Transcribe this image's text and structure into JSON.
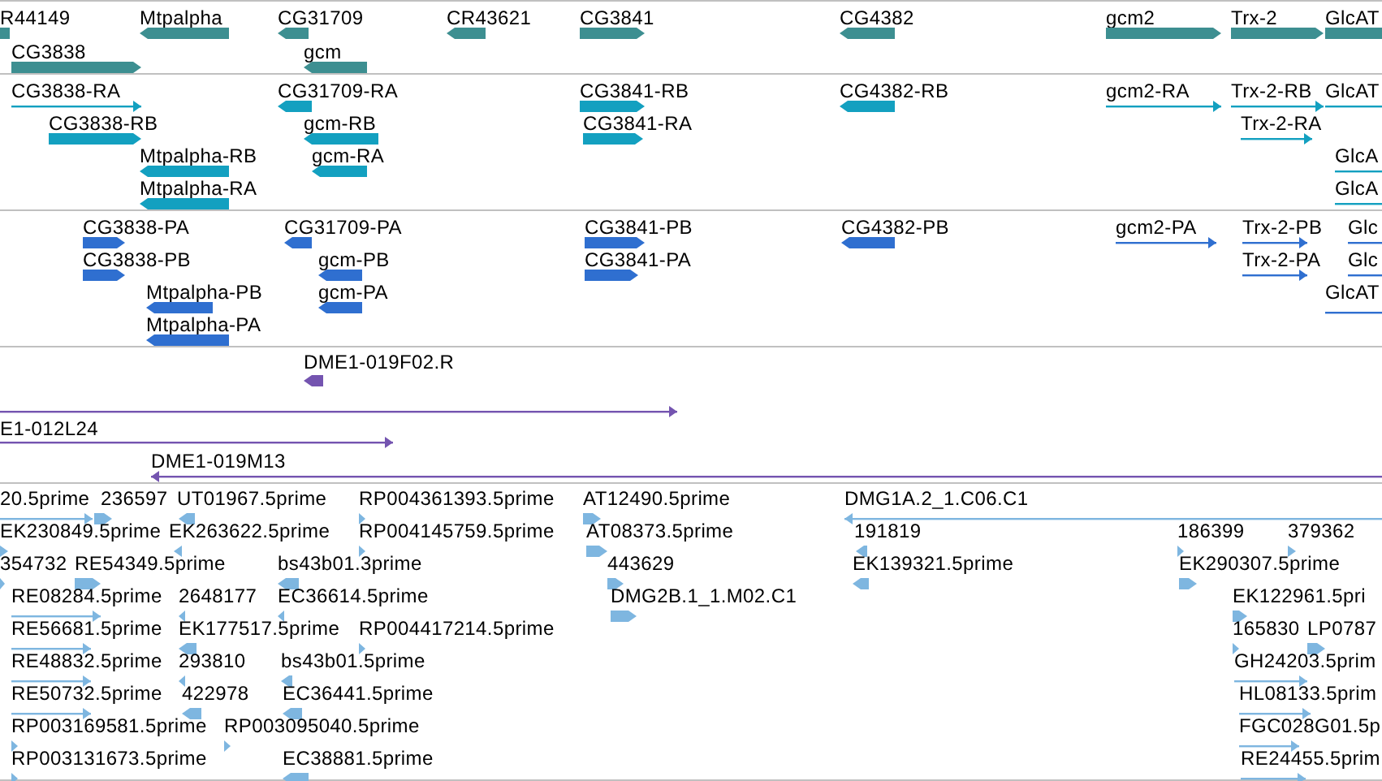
{
  "tracks": [
    {
      "color": "#3d8f91",
      "features": [
        {
          "label": "R44149"
        },
        {
          "label": "Mtpalpha",
          "reverse": true
        },
        {
          "label": "CG31709",
          "reverse": true
        },
        {
          "label": "CR43621",
          "reverse": true
        },
        {
          "label": "CG3841",
          "reverse": false
        },
        {
          "label": "CG4382",
          "reverse": true
        },
        {
          "label": "gcm2",
          "reverse": false
        },
        {
          "label": "Trx-2",
          "reverse": false
        },
        {
          "label": "GlcAT"
        },
        {
          "label": "CG3838",
          "reverse": false
        },
        {
          "label": "gcm",
          "reverse": true
        }
      ]
    },
    {
      "color": "#13a0c0",
      "features": [
        {
          "label": "CG3838-RA",
          "reverse": false
        },
        {
          "label": "CG31709-RA",
          "reverse": true
        },
        {
          "label": "CG3841-RB",
          "reverse": false
        },
        {
          "label": "CG4382-RB",
          "reverse": true
        },
        {
          "label": "gcm2-RA",
          "reverse": false
        },
        {
          "label": "Trx-2-RB",
          "reverse": false
        },
        {
          "label": "GlcAT"
        },
        {
          "label": "CG3838-RB",
          "reverse": false
        },
        {
          "label": "gcm-RB",
          "reverse": true
        },
        {
          "label": "CG3841-RA",
          "reverse": false
        },
        {
          "label": "Trx-2-RA",
          "reverse": false
        },
        {
          "label": "Mtpalpha-RB",
          "reverse": true
        },
        {
          "label": "gcm-RA",
          "reverse": true
        },
        {
          "label": "GlcA"
        },
        {
          "label": "Mtpalpha-RA",
          "reverse": true
        },
        {
          "label": "GlcA"
        }
      ]
    },
    {
      "color": "#2f6fd0",
      "features": [
        {
          "label": "CG3838-PA",
          "reverse": false
        },
        {
          "label": "CG31709-PA",
          "reverse": true
        },
        {
          "label": "CG3841-PB",
          "reverse": false
        },
        {
          "label": "CG4382-PB",
          "reverse": true
        },
        {
          "label": "gcm2-PA",
          "reverse": false
        },
        {
          "label": "Trx-2-PB",
          "reverse": false
        },
        {
          "label": "Glc"
        },
        {
          "label": "CG3838-PB",
          "reverse": false
        },
        {
          "label": "gcm-PB",
          "reverse": true
        },
        {
          "label": "CG3841-PA",
          "reverse": false
        },
        {
          "label": "Trx-2-PA",
          "reverse": false
        },
        {
          "label": "Glc"
        },
        {
          "label": "Mtpalpha-PB",
          "reverse": true
        },
        {
          "label": "gcm-PA",
          "reverse": true
        },
        {
          "label": "GlcAT"
        },
        {
          "label": "Mtpalpha-PA",
          "reverse": true
        }
      ]
    },
    {
      "color": "#7454b0",
      "features": [
        {
          "label": "DME1-019F02.R",
          "reverse": true
        },
        {
          "reverse": false
        },
        {
          "label": "E1-012L24",
          "reverse": false
        },
        {
          "label": "DME1-019M13",
          "reverse": true
        }
      ]
    },
    {
      "color": "#7eb6e0",
      "features": [
        {
          "label": "20.5prime",
          "reverse": false
        },
        {
          "label": "236597",
          "reverse": false
        },
        {
          "label": "UT01967.5prime",
          "reverse": true
        },
        {
          "label": "RP004361393.5prime",
          "reverse": false
        },
        {
          "label": "AT12490.5prime",
          "reverse": false
        },
        {
          "label": "DMG1A.2_1.C06.C1",
          "reverse": true
        },
        {
          "label": "EK230849.5prime",
          "reverse": false
        },
        {
          "label": "EK263622.5prime",
          "reverse": true
        },
        {
          "label": "RP004145759.5prime",
          "reverse": false
        },
        {
          "label": "AT08373.5prime",
          "reverse": false
        },
        {
          "label": "191819",
          "reverse": true
        },
        {
          "label": "186399",
          "reverse": false
        },
        {
          "label": "379362",
          "reverse": false
        },
        {
          "label": "354732",
          "reverse": false
        },
        {
          "label": "RE54349.5prime",
          "reverse": false
        },
        {
          "label": "bs43b01.3prime",
          "reverse": true
        },
        {
          "label": "443629",
          "reverse": false
        },
        {
          "label": "EK139321.5prime",
          "reverse": true
        },
        {
          "label": "EK290307.5prime",
          "reverse": false
        },
        {
          "label": "RE08284.5prime",
          "reverse": false
        },
        {
          "label": "2648177",
          "reverse": true
        },
        {
          "label": "EC36614.5prime",
          "reverse": true
        },
        {
          "label": "DMG2B.1_1.M02.C1",
          "reverse": false
        },
        {
          "label": "EK122961.5pri",
          "reverse": false
        },
        {
          "label": "RE56681.5prime",
          "reverse": false
        },
        {
          "label": "EK177517.5prime",
          "reverse": true
        },
        {
          "label": "RP004417214.5prime",
          "reverse": false
        },
        {
          "label": "165830",
          "reverse": false
        },
        {
          "label": "LP0787",
          "reverse": false
        },
        {
          "label": "RE48832.5prime",
          "reverse": false
        },
        {
          "label": "293810",
          "reverse": true
        },
        {
          "label": "bs43b01.5prime",
          "reverse": true
        },
        {
          "label": "GH24203.5prim",
          "reverse": false
        },
        {
          "label": "RE50732.5prime",
          "reverse": false
        },
        {
          "label": "422978",
          "reverse": true
        },
        {
          "label": "EC36441.5prime",
          "reverse": true
        },
        {
          "label": "HL08133.5prim",
          "reverse": false
        },
        {
          "label": "RP003169581.5prime",
          "reverse": false
        },
        {
          "label": "RP003095040.5prime",
          "reverse": false
        },
        {
          "label": "FGC028G01.5p",
          "reverse": false
        },
        {
          "label": "RP003131673.5prime",
          "reverse": false
        },
        {
          "label": "EC38881.5prime",
          "reverse": true
        },
        {
          "label": "RE24455.5prim",
          "reverse": false
        }
      ]
    }
  ]
}
